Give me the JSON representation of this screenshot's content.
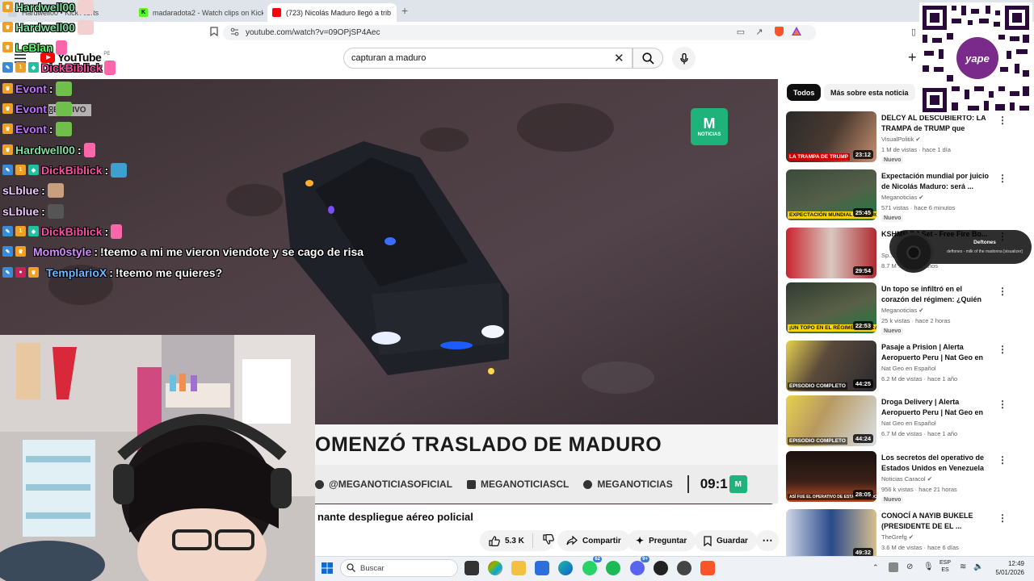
{
  "browser": {
    "tabs": [
      {
        "label": "Hardwell00 • Kick Alerts",
        "icon_color": "#dfe3ea"
      },
      {
        "label": "madaradota2 - Watch clips on Kick",
        "icon_color": "#53fc18"
      },
      {
        "label": "(723) Nicolás Maduro llegó a trib",
        "icon_color": "#ff0000"
      }
    ],
    "new_tab": "+",
    "url": "youtube.com/watch?v=09OPjSP4Aec"
  },
  "youtube": {
    "logo_text": "YouTube",
    "region": "PE",
    "search_query": "capturan a maduro",
    "clear_icon": "✕",
    "create_icon": "+"
  },
  "video": {
    "news_logo_mark": "M",
    "news_logo_text": "NOTICIAS",
    "lower_third": "OMENZÓ TRASLADO DE MADURO",
    "ticker": [
      "@MEGANOTICIASOFICIAL",
      "MEGANOTICIASCL",
      "MEGANOTICIAS"
    ],
    "ticker_time": "09:1",
    "live_badge": "EN VIVO",
    "title": "nante despliegue aéreo policial"
  },
  "actions": {
    "likes": "5.3 K",
    "share": "Compartir",
    "ask": "Preguntar",
    "save": "Guardar",
    "more": "⋯"
  },
  "sidebar": {
    "chip_all": "Todos",
    "chip_more": "Más sobre esta noticia",
    "recommendations": [
      {
        "title": "DELCY AL DESCUBIERTO: LA TRAMPA de TRUMP que permitió ...",
        "channel": "VisualPolitik",
        "meta": "1 M de vistas · hace 1 día",
        "badge": "Nuevo",
        "duration": "23:12",
        "thumb_label": "LA TRAMPA DE TRUMP",
        "verified": true
      },
      {
        "title": "Expectación mundial por juicio de Nicolás Maduro: será ...",
        "channel": "Meganoticias",
        "meta": "571 vistas · hace 6 minutos",
        "badge": "Nuevo",
        "duration": "25:45",
        "thumb_label": "EXPECTACIÓN MUNDIAL POR JUICIO A MADURO",
        "verified": true
      },
      {
        "title": "KSHMR DJ Set - Free Fire Bo...",
        "channel": "Sp...",
        "meta": "8.7 M ... hace 5 años",
        "badge": "",
        "duration": "29:54",
        "thumb_label": "",
        "verified": false
      },
      {
        "title": "Un topo se infiltró en el corazón del régimen: ¿Quién traicionó ...",
        "channel": "Meganoticias",
        "meta": "25 k vistas · hace 2 horas",
        "badge": "Nuevo",
        "duration": "22:53",
        "thumb_label": "¡UN TOPO EN EL RÉGIMEN! ASÍ CAYÓ NICOLÁS MADURO",
        "verified": true
      },
      {
        "title": "Pasaje a Prision | Alerta Aeropuerto Peru | Nat Geo en ...",
        "channel": "Nat Geo en Español",
        "meta": "6.2 M de vistas · hace 1 año",
        "badge": "",
        "duration": "44:25",
        "thumb_label": "EPISODIO COMPLETO",
        "verified": false
      },
      {
        "title": "Droga Delivery | Alerta Aeropuerto Peru | Nat Geo en ...",
        "channel": "Nat Geo en Español",
        "meta": "6.7 M de vistas · hace 1 año",
        "badge": "",
        "duration": "44:24",
        "thumb_label": "EPISODIO COMPLETO",
        "verified": false
      },
      {
        "title": "Los secretos del operativo de Estados Unidos en Venezuela ...",
        "channel": "Noticias Caracol",
        "meta": "956 k vistas · hace 21 horas",
        "badge": "Nuevo",
        "duration": "28:05",
        "thumb_label": "ASÍ FUE EL OPERATIVO DE ESTADOS UNIDOS EN VENEZUELA",
        "verified": true
      },
      {
        "title": "CONOCÍ A NAYIB BUKELE (PRESIDENTE DE EL ...",
        "channel": "TheGrefg",
        "meta": "3.6 M de vistas · hace 6 días",
        "badge": "",
        "duration": "49:32",
        "thumb_label": "",
        "verified": true
      }
    ],
    "menu_icon": "⋮"
  },
  "overlays": {
    "qr_brand": "yape",
    "music_artist": "Deftones",
    "music_track": "deftones - milk of the madonna [visualizer]",
    "chat": [
      {
        "name": "Hardwell00",
        "color": "#7fe0a0",
        "message": "",
        "emote": "#f3d0d0"
      },
      {
        "name": "Hardwell00",
        "color": "#7fe0a0",
        "message": "",
        "emote": "#f3d0d0"
      },
      {
        "name": "LeBlan",
        "color": "#5bff68",
        "message": "",
        "emote": "#ff66aa"
      },
      {
        "name": "DickBiblick",
        "color": "#ff4da6",
        "message": "",
        "emote": "#ff66aa"
      },
      {
        "name": "Evont",
        "color": "#c070ff",
        "message": "",
        "emote": "#6fbf4a"
      },
      {
        "name": "Evont",
        "color": "#c070ff",
        "message": "",
        "emote": "#6fbf4a"
      },
      {
        "name": "Evont",
        "color": "#c070ff",
        "message": "",
        "emote": "#6fbf4a"
      },
      {
        "name": "Hardwell00",
        "color": "#7fe0a0",
        "message": "",
        "emote": "#ff66aa"
      },
      {
        "name": "DickBiblick",
        "color": "#ff4da6",
        "message": "",
        "emote": "#3ca0d0"
      },
      {
        "name": "sLblue",
        "color": "#f0c8ff",
        "message": "",
        "emote": "#c8a080"
      },
      {
        "name": "sLblue",
        "color": "#f0c8ff",
        "message": "",
        "emote": "#555555"
      },
      {
        "name": "DickBiblick",
        "color": "#ff4da6",
        "message": "",
        "emote": "#ff66aa"
      },
      {
        "name": "Mom0style",
        "color": "#d58cff",
        "message": "!teemo a mi me vieron viendote y se cago de risa",
        "emote": ""
      },
      {
        "name": "TemplarioX",
        "color": "#6fb7ff",
        "message": "!teemo me quieres?",
        "emote": ""
      }
    ]
  },
  "taskbar": {
    "search_placeholder": "Buscar",
    "whatsapp_count": "62",
    "discord_count": "9+",
    "lang": "ESP",
    "lang_sub": "ES",
    "time": "12:49",
    "date": "5/01/2026"
  }
}
